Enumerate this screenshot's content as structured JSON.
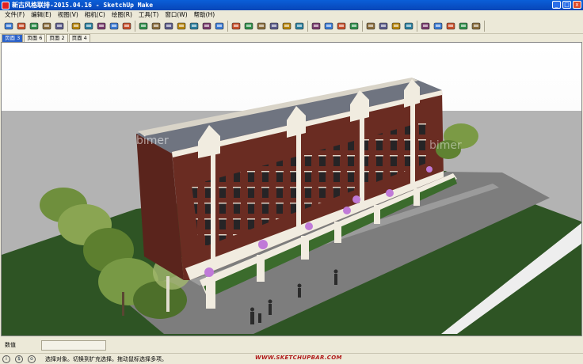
{
  "window": {
    "title": "新古风格联排-2015.04.16 - SketchUp Make",
    "app_icon": "sketchup-icon",
    "controls": [
      "minimize-icon",
      "maximize-icon",
      "close-icon"
    ]
  },
  "menu": {
    "items": [
      "文件(F)",
      "编辑(E)",
      "视图(V)",
      "相机(C)",
      "绘图(R)",
      "工具(T)",
      "窗口(W)",
      "帮助(H)"
    ]
  },
  "toolbar": {
    "icons": [
      "select-icon",
      "eraser-icon",
      "paint-bucket-icon",
      "rectangle-icon",
      "line-icon",
      "push-pull-icon",
      "move-icon",
      "rotate-icon",
      "offset-icon",
      "tape-measure-icon",
      "orbit-icon",
      "pan-icon",
      "zoom-icon",
      "zoom-window-icon",
      "zoom-extents-icon",
      "position-camera-icon",
      "look-around-icon",
      "walk-icon",
      "iso-view-icon",
      "top-view-icon",
      "front-view-icon",
      "right-view-icon",
      "back-view-icon",
      "left-view-icon",
      "3d-warehouse-icon",
      "share-model-icon",
      "get-models-icon",
      "share-component-icon",
      "sandbox-icon",
      "smoove-icon",
      "stamp-icon",
      "drape-icon",
      "undo-icon",
      "redo-icon",
      "print-icon",
      "extension-warehouse-icon"
    ]
  },
  "tabs": {
    "items": [
      "页面 3",
      "页面 6",
      "页面 2",
      "页面 4"
    ],
    "active_index": 0
  },
  "measurements": {
    "label": "数值",
    "value": ""
  },
  "watermark": {
    "text": "WWW.SKETCHUPBAR.COM"
  },
  "status": {
    "icons": [
      "info-icon",
      "credits-icon",
      "user-icon"
    ],
    "text": "选择对象。切换到扩充选择。拖动鼠标选择多项。"
  },
  "scene": {
    "sky_color": "#ffffff",
    "ground_color": "#b3b3b3",
    "lawn_color": "#2e5424",
    "road_color": "#7d7d7d",
    "brick_color": "#6a2c22",
    "roof_color": "#6f7480",
    "trim_color": "#f1ece0"
  }
}
